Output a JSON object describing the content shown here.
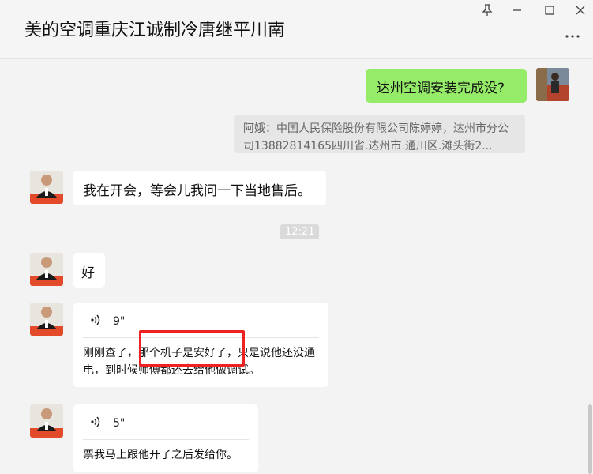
{
  "window": {
    "title": "美的空调重庆江诚制冷唐继平川南",
    "pin_icon": "pin-icon",
    "minimize_icon": "minimize-icon",
    "maximize_icon": "maximize-icon",
    "close_icon": "close-icon",
    "more_icon": "more-icon"
  },
  "messages": {
    "m1": {
      "text": "达州空调安装完成没?"
    },
    "quote": {
      "text": "阿娥：中国人民保险股份有限公司陈婷婷，达州市分公司13882814165四川省.达州市.通川区.滩头街2..."
    },
    "m2": {
      "text": "我在开会，等会儿我问一下当地售后。"
    },
    "time": {
      "text": "12:21"
    },
    "m3": {
      "text": "好"
    },
    "v1": {
      "duration": "9\"",
      "transcript": "刚刚查了，那个机子是安好了，只是说他还没通电，到时候师傅都还去给他做调试。"
    },
    "v2": {
      "duration": "5\"",
      "transcript": "票我马上跟他开了之后发给你。"
    }
  },
  "colors": {
    "bubble_self": "#95ec69",
    "bubble_other": "#ffffff",
    "highlight": "#e22222"
  }
}
